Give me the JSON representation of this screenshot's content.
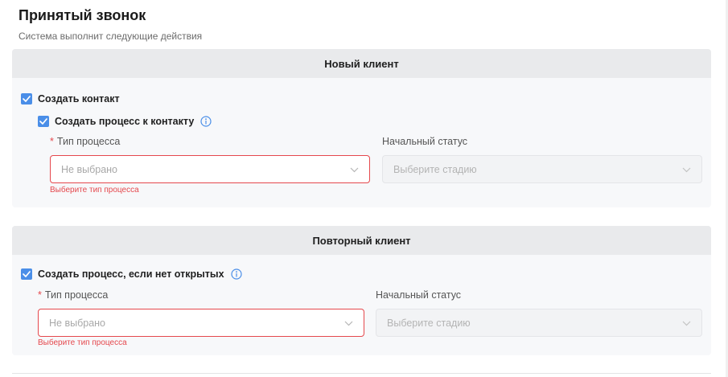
{
  "page": {
    "title": "Принятый звонок",
    "subtitle": "Система выполнит следующие действия"
  },
  "sections": {
    "new_client": {
      "header": "Новый клиент",
      "create_contact_label": "Создать контакт",
      "create_process_label": "Создать процесс к контакту",
      "process_type_label": "Тип процесса",
      "process_type_value": "Не выбрано",
      "process_type_error": "Выберите тип процесса",
      "initial_status_label": "Начальный статус",
      "initial_status_placeholder": "Выберите стадию"
    },
    "repeat_client": {
      "header": "Повторный клиент",
      "create_process_label": "Создать процесс, если нет открытых",
      "process_type_label": "Тип процесса",
      "process_type_value": "Не выбрано",
      "process_type_error": "Выберите тип процесса",
      "initial_status_label": "Начальный статус",
      "initial_status_placeholder": "Выберите стадию"
    }
  },
  "required_mark": "*",
  "icons": {
    "checkbox": "checkmark-icon",
    "info": "info-icon",
    "dropdown": "chevron-down-icon"
  },
  "colors": {
    "accent": "#4a8ee8",
    "error": "#e5484d",
    "header_bg": "#e9eaec",
    "card_bg": "#f7f8fa"
  }
}
